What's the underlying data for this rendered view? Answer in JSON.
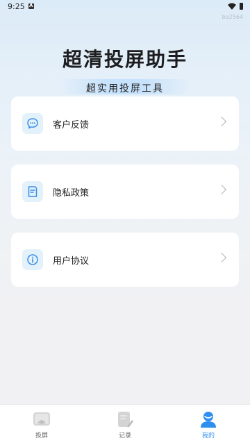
{
  "status_bar": {
    "time": "9:25"
  },
  "watermark": "ba2564",
  "hero": {
    "title": "超清投屏助手",
    "subtitle": "超实用投屏工具"
  },
  "menu": [
    {
      "label": "客户反馈",
      "icon": "chat-bubble-icon"
    },
    {
      "label": "隐私政策",
      "icon": "document-icon"
    },
    {
      "label": "用户协议",
      "icon": "info-icon"
    }
  ],
  "tabbar": {
    "items": [
      {
        "label": "投屏",
        "icon": "cast-icon",
        "active": false
      },
      {
        "label": "记录",
        "icon": "record-icon",
        "active": false
      },
      {
        "label": "我的",
        "icon": "profile-icon",
        "active": true
      }
    ]
  },
  "colors": {
    "accent": "#2f8ff0",
    "icon_bg": "#e3f1fb",
    "icon_stroke": "#3a8ee6"
  }
}
